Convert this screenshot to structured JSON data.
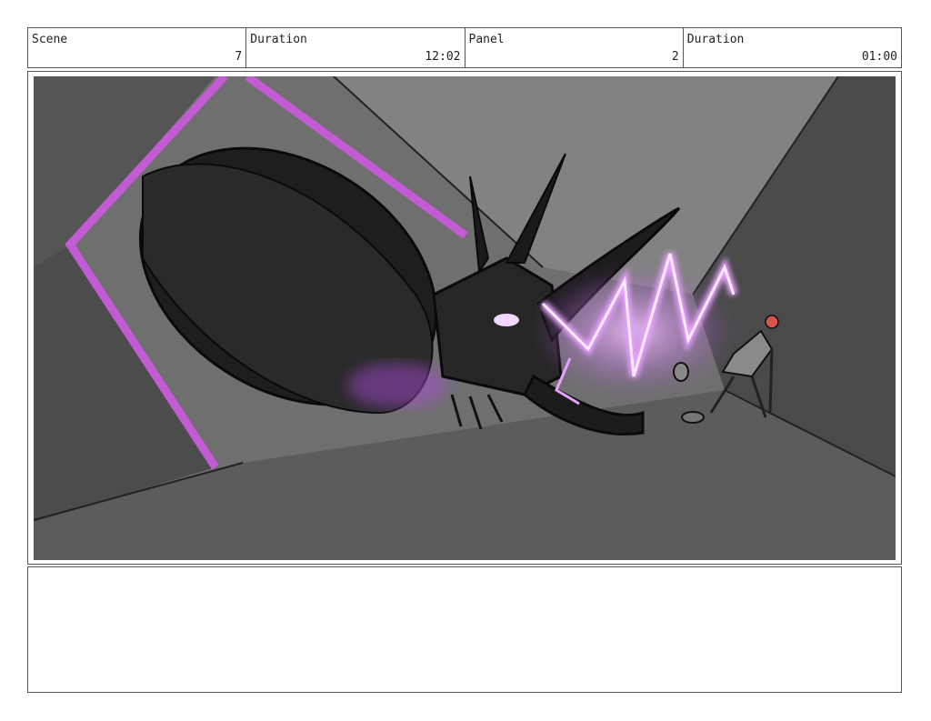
{
  "header": {
    "scene": {
      "label": "Scene",
      "value": "7"
    },
    "scene_duration": {
      "label": "Duration",
      "value": "12:02"
    },
    "panel": {
      "label": "Panel",
      "value": "2"
    },
    "panel_duration": {
      "label": "Duration",
      "value": "01:00"
    }
  },
  "panel_image": {
    "accent_color": "#c25bd4",
    "glow_color": "#e8a0ff",
    "bg_color": "#6f6f6f"
  },
  "notes": {
    "text": ""
  }
}
